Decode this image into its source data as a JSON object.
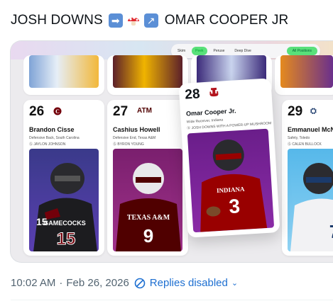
{
  "post": {
    "name_left": "JOSH DOWNS",
    "name_right": "OMAR COOPER JR",
    "icons": [
      "right-arrow-emoji",
      "mushroom-emoji",
      "up-right-arrow-emoji"
    ]
  },
  "filters": {
    "tabs": [
      "Skim",
      "Peek",
      "Peruse",
      "Deep Dive"
    ],
    "active_tab": "Peek",
    "select_value": "All Positions"
  },
  "cards": [
    {
      "number": "26",
      "name": "Brandon Cisse",
      "position": "Defensive Back, South Carolina",
      "comparison": "JAYLON JOHNSON",
      "jersey": "15",
      "team_text": "GAMECOCKS",
      "team_color": "#73000a"
    },
    {
      "number": "27",
      "name": "Cashius Howell",
      "position": "Defensive End, Texas A&M",
      "comparison": "BYRON YOUNG",
      "jersey": "9",
      "team_text": "TEXAS A&M",
      "team_color": "#500000"
    },
    {
      "number": "29",
      "name": "Emmanuel McNe",
      "position": "Safety, Toledo",
      "comparison": "CALEN BULLOCK",
      "jersey": "7",
      "team_text": "",
      "team_color": "#1b3a6b"
    }
  ],
  "feature": {
    "number": "28",
    "name": "Omar Cooper Jr.",
    "position": "Wide Receiver, Indiana",
    "comparison": "JOSH DOWNS WITH A POWER-UP MUSHROOM",
    "jersey": "3",
    "team_text": "INDIANA",
    "team_color": "#990000"
  },
  "meta": {
    "time": "10:02 AM",
    "date": "Feb 26, 2026",
    "replies": "Replies disabled"
  },
  "colors": {
    "link": "#1d6fd1",
    "muted": "#536471",
    "accent_green": "#59e07a"
  }
}
